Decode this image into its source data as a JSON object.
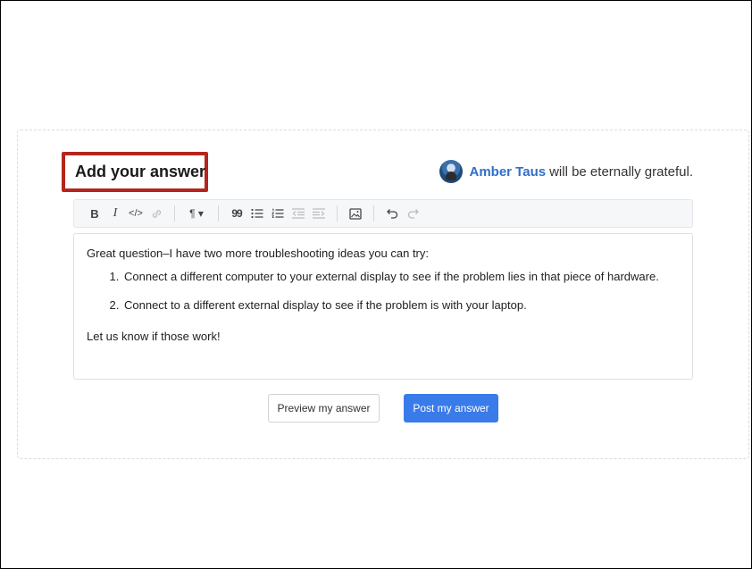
{
  "answer": {
    "title": "Add your answer",
    "user_name": "Amber Taus",
    "grateful_suffix": "will be eternally grateful."
  },
  "toolbar": {
    "bold": "B",
    "italic": "I",
    "code": "</>",
    "paragraph": "¶ ▾",
    "quote": "99"
  },
  "editor": {
    "intro": "Great question–I have two more troubleshooting ideas you can try:",
    "items": [
      "Connect a different computer to your external display to see if the problem lies in that piece of hardware.",
      "Connect to a different external display to see if the problem is with your laptop."
    ],
    "outro": "Let us know if those work!"
  },
  "buttons": {
    "preview": "Preview my answer",
    "post": "Post my answer"
  },
  "colors": {
    "accent": "#3a7bea",
    "user_link": "#2f6fc9",
    "highlight_box": "#b5251d"
  },
  "icons": [
    "bold-icon",
    "italic-icon",
    "code-icon",
    "link-icon",
    "paragraph-icon",
    "quote-icon",
    "bullet-list-icon",
    "numbered-list-icon",
    "outdent-icon",
    "indent-icon",
    "image-icon",
    "undo-icon",
    "redo-icon"
  ]
}
